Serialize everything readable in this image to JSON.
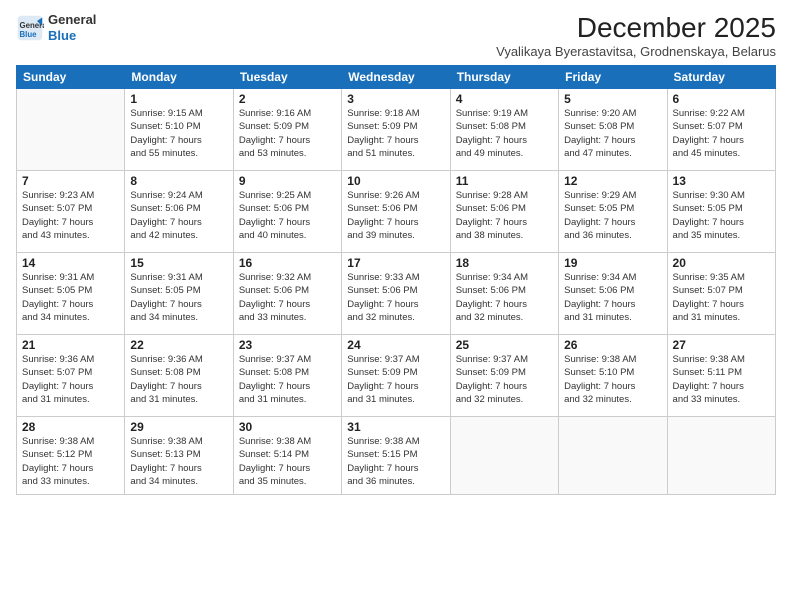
{
  "header": {
    "logo_general": "General",
    "logo_blue": "Blue",
    "month_title": "December 2025",
    "location": "Vyalikaya Byerastavitsa, Grodnenskaya, Belarus"
  },
  "weekdays": [
    "Sunday",
    "Monday",
    "Tuesday",
    "Wednesday",
    "Thursday",
    "Friday",
    "Saturday"
  ],
  "weeks": [
    [
      {
        "day": "",
        "info": ""
      },
      {
        "day": "1",
        "info": "Sunrise: 9:15 AM\nSunset: 5:10 PM\nDaylight: 7 hours\nand 55 minutes."
      },
      {
        "day": "2",
        "info": "Sunrise: 9:16 AM\nSunset: 5:09 PM\nDaylight: 7 hours\nand 53 minutes."
      },
      {
        "day": "3",
        "info": "Sunrise: 9:18 AM\nSunset: 5:09 PM\nDaylight: 7 hours\nand 51 minutes."
      },
      {
        "day": "4",
        "info": "Sunrise: 9:19 AM\nSunset: 5:08 PM\nDaylight: 7 hours\nand 49 minutes."
      },
      {
        "day": "5",
        "info": "Sunrise: 9:20 AM\nSunset: 5:08 PM\nDaylight: 7 hours\nand 47 minutes."
      },
      {
        "day": "6",
        "info": "Sunrise: 9:22 AM\nSunset: 5:07 PM\nDaylight: 7 hours\nand 45 minutes."
      }
    ],
    [
      {
        "day": "7",
        "info": "Sunrise: 9:23 AM\nSunset: 5:07 PM\nDaylight: 7 hours\nand 43 minutes."
      },
      {
        "day": "8",
        "info": "Sunrise: 9:24 AM\nSunset: 5:06 PM\nDaylight: 7 hours\nand 42 minutes."
      },
      {
        "day": "9",
        "info": "Sunrise: 9:25 AM\nSunset: 5:06 PM\nDaylight: 7 hours\nand 40 minutes."
      },
      {
        "day": "10",
        "info": "Sunrise: 9:26 AM\nSunset: 5:06 PM\nDaylight: 7 hours\nand 39 minutes."
      },
      {
        "day": "11",
        "info": "Sunrise: 9:28 AM\nSunset: 5:06 PM\nDaylight: 7 hours\nand 38 minutes."
      },
      {
        "day": "12",
        "info": "Sunrise: 9:29 AM\nSunset: 5:05 PM\nDaylight: 7 hours\nand 36 minutes."
      },
      {
        "day": "13",
        "info": "Sunrise: 9:30 AM\nSunset: 5:05 PM\nDaylight: 7 hours\nand 35 minutes."
      }
    ],
    [
      {
        "day": "14",
        "info": "Sunrise: 9:31 AM\nSunset: 5:05 PM\nDaylight: 7 hours\nand 34 minutes."
      },
      {
        "day": "15",
        "info": "Sunrise: 9:31 AM\nSunset: 5:05 PM\nDaylight: 7 hours\nand 34 minutes."
      },
      {
        "day": "16",
        "info": "Sunrise: 9:32 AM\nSunset: 5:06 PM\nDaylight: 7 hours\nand 33 minutes."
      },
      {
        "day": "17",
        "info": "Sunrise: 9:33 AM\nSunset: 5:06 PM\nDaylight: 7 hours\nand 32 minutes."
      },
      {
        "day": "18",
        "info": "Sunrise: 9:34 AM\nSunset: 5:06 PM\nDaylight: 7 hours\nand 32 minutes."
      },
      {
        "day": "19",
        "info": "Sunrise: 9:34 AM\nSunset: 5:06 PM\nDaylight: 7 hours\nand 31 minutes."
      },
      {
        "day": "20",
        "info": "Sunrise: 9:35 AM\nSunset: 5:07 PM\nDaylight: 7 hours\nand 31 minutes."
      }
    ],
    [
      {
        "day": "21",
        "info": "Sunrise: 9:36 AM\nSunset: 5:07 PM\nDaylight: 7 hours\nand 31 minutes."
      },
      {
        "day": "22",
        "info": "Sunrise: 9:36 AM\nSunset: 5:08 PM\nDaylight: 7 hours\nand 31 minutes."
      },
      {
        "day": "23",
        "info": "Sunrise: 9:37 AM\nSunset: 5:08 PM\nDaylight: 7 hours\nand 31 minutes."
      },
      {
        "day": "24",
        "info": "Sunrise: 9:37 AM\nSunset: 5:09 PM\nDaylight: 7 hours\nand 31 minutes."
      },
      {
        "day": "25",
        "info": "Sunrise: 9:37 AM\nSunset: 5:09 PM\nDaylight: 7 hours\nand 32 minutes."
      },
      {
        "day": "26",
        "info": "Sunrise: 9:38 AM\nSunset: 5:10 PM\nDaylight: 7 hours\nand 32 minutes."
      },
      {
        "day": "27",
        "info": "Sunrise: 9:38 AM\nSunset: 5:11 PM\nDaylight: 7 hours\nand 33 minutes."
      }
    ],
    [
      {
        "day": "28",
        "info": "Sunrise: 9:38 AM\nSunset: 5:12 PM\nDaylight: 7 hours\nand 33 minutes."
      },
      {
        "day": "29",
        "info": "Sunrise: 9:38 AM\nSunset: 5:13 PM\nDaylight: 7 hours\nand 34 minutes."
      },
      {
        "day": "30",
        "info": "Sunrise: 9:38 AM\nSunset: 5:14 PM\nDaylight: 7 hours\nand 35 minutes."
      },
      {
        "day": "31",
        "info": "Sunrise: 9:38 AM\nSunset: 5:15 PM\nDaylight: 7 hours\nand 36 minutes."
      },
      {
        "day": "",
        "info": ""
      },
      {
        "day": "",
        "info": ""
      },
      {
        "day": "",
        "info": ""
      }
    ]
  ]
}
